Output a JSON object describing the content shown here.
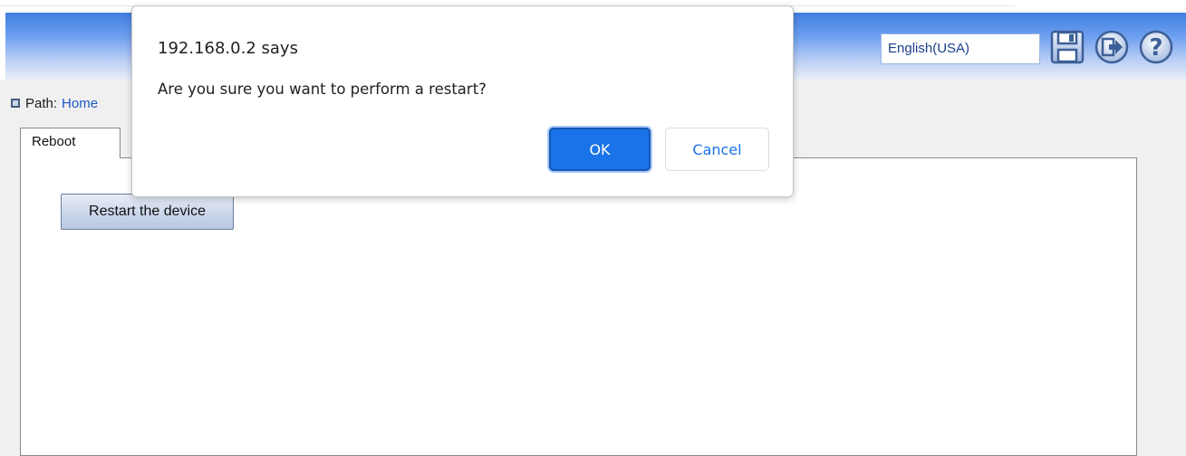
{
  "header": {
    "language": "English(USA)",
    "icons": [
      "save-icon",
      "logout-icon",
      "help-icon"
    ]
  },
  "path": {
    "label": "Path:",
    "home": "Home"
  },
  "tab": {
    "label": "Reboot"
  },
  "panel": {
    "restart_label": "Restart the device"
  },
  "dialog": {
    "title": "192.168.0.2 says",
    "message": "Are you sure you want to perform a restart?",
    "ok_label": "OK",
    "cancel_label": "Cancel"
  },
  "colors": {
    "header_blue": "#3f7fe0",
    "dialog_ok": "#1a73e8",
    "link": "#1c57c4"
  }
}
